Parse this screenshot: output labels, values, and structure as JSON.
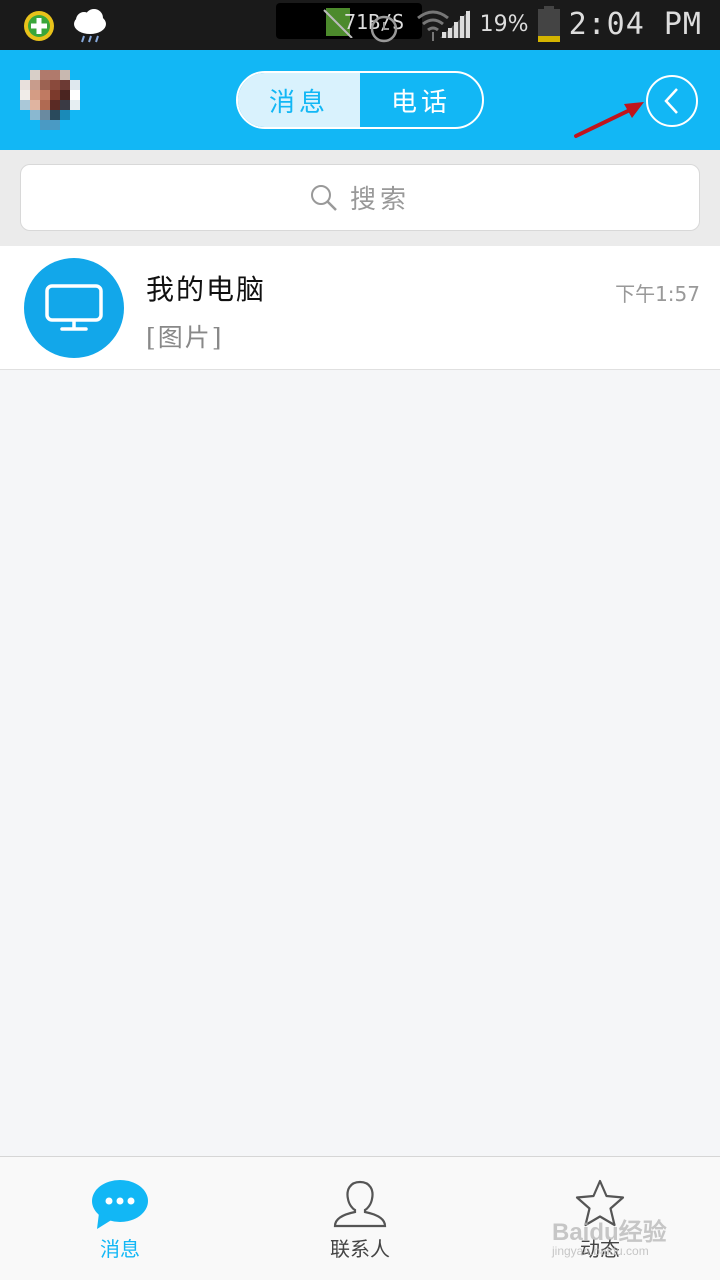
{
  "status_bar": {
    "net_speed": "71B/S",
    "battery_percent": "19%",
    "time": "2:04 PM",
    "icons": [
      "app-plus-icon",
      "weather-cloud-rain-icon",
      "wifi-icon",
      "no-sim-icon",
      "alarm-icon",
      "wifi-transfer-icon",
      "signal-icon",
      "battery-icon"
    ]
  },
  "header": {
    "tabs": [
      {
        "label": "消息",
        "active": true
      },
      {
        "label": "电话",
        "active": false
      }
    ],
    "back_icon": "chevron-left-icon",
    "accent_color": "#12b7f5"
  },
  "search": {
    "placeholder": "搜索"
  },
  "conversations": [
    {
      "title": "我的电脑",
      "preview": "[图片]",
      "time": "下午1:57",
      "icon": "monitor-icon"
    }
  ],
  "bottom_nav": {
    "items": [
      {
        "label": "消息",
        "icon": "chat-bubble-icon",
        "active": true
      },
      {
        "label": "联系人",
        "icon": "person-icon",
        "active": false
      },
      {
        "label": "动态",
        "icon": "star-icon",
        "active": false
      }
    ]
  },
  "watermark": {
    "text": "Baidu经验",
    "sub": "jingyan.baidu.com"
  }
}
